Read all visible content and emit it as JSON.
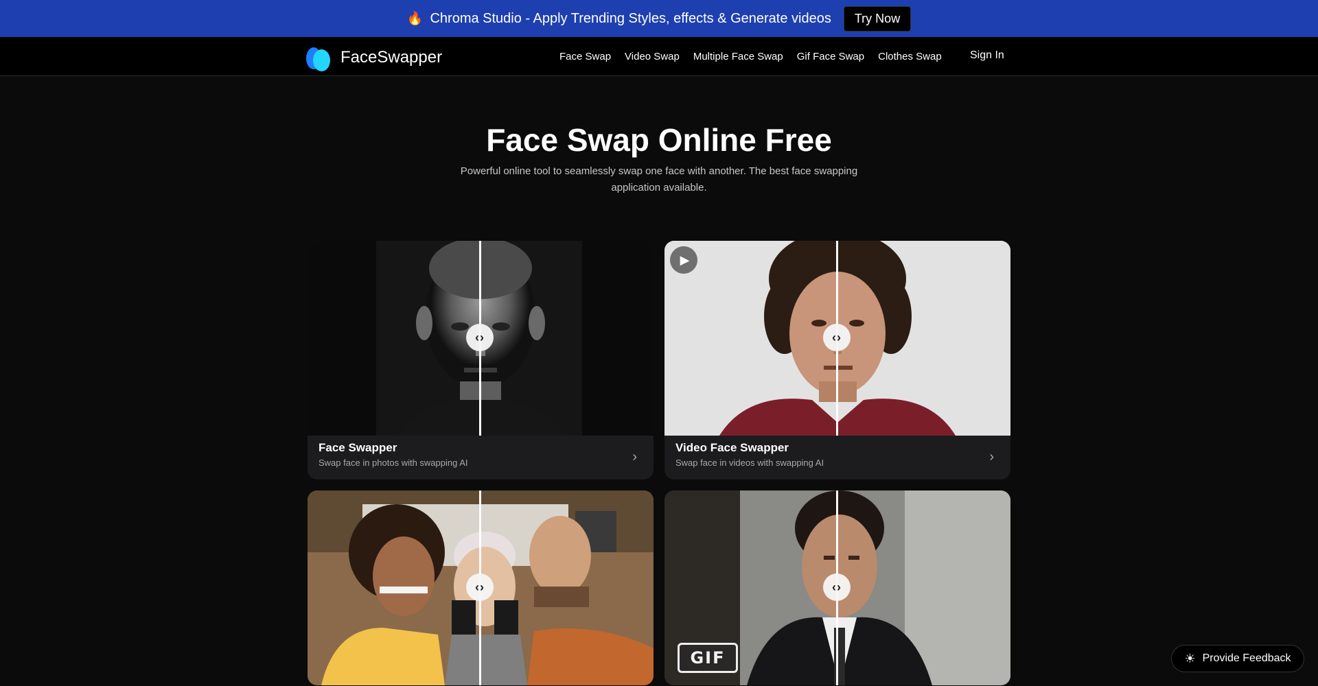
{
  "promo": {
    "icon": "fire-icon",
    "text": "Chroma Studio - Apply Trending Styles, effects & Generate videos",
    "cta_label": "Try Now",
    "background_color": "#1d3fb0"
  },
  "navbar": {
    "brand": "FaceSwapper",
    "links": [
      "Face Swap",
      "Video Swap",
      "Multiple Face Swap",
      "Gif Face Swap",
      "Clothes Swap"
    ],
    "sign_in_label": "Sign In"
  },
  "hero": {
    "title": "Face Swap Online Free",
    "subtitle": "Powerful online tool to seamlessly swap one face with another. The best face swapping application available."
  },
  "cards": [
    {
      "title": "Face Swapper",
      "description": "Swap face in photos with swapping AI",
      "handle_icon": "compare-arrows-icon"
    },
    {
      "title": "Video Face Swapper",
      "description": "Swap face in videos with swapping AI",
      "handle_icon": "compare-arrows-icon",
      "overlay_icon": "play-icon"
    },
    {
      "title": "",
      "description": "",
      "handle_icon": "compare-arrows-icon"
    },
    {
      "title": "",
      "description": "",
      "handle_icon": "compare-arrows-icon",
      "badge": "GIF"
    }
  ],
  "feedback": {
    "icon": "lightbulb-icon",
    "label": "Provide  Feedback"
  }
}
